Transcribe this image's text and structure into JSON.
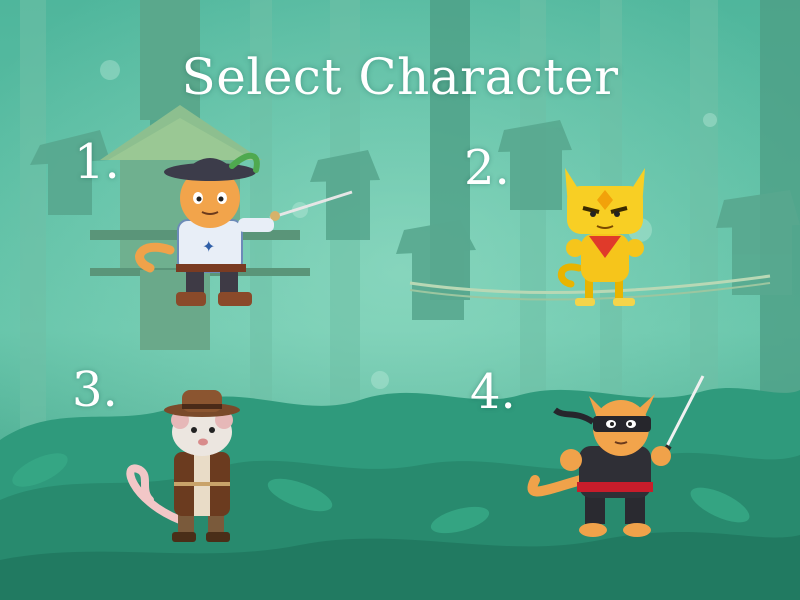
{
  "screen": {
    "title": "Select Character"
  },
  "characters": [
    {
      "number": "1.",
      "icon": "musketeer-cat-icon"
    },
    {
      "number": "2.",
      "icon": "yellow-pixel-cat-icon"
    },
    {
      "number": "3.",
      "icon": "explorer-rat-icon"
    },
    {
      "number": "4.",
      "icon": "ninja-cat-icon"
    }
  ],
  "colors": {
    "background": "#3fa08a",
    "text": "#ffffff",
    "foliage": "#2c8f74"
  }
}
